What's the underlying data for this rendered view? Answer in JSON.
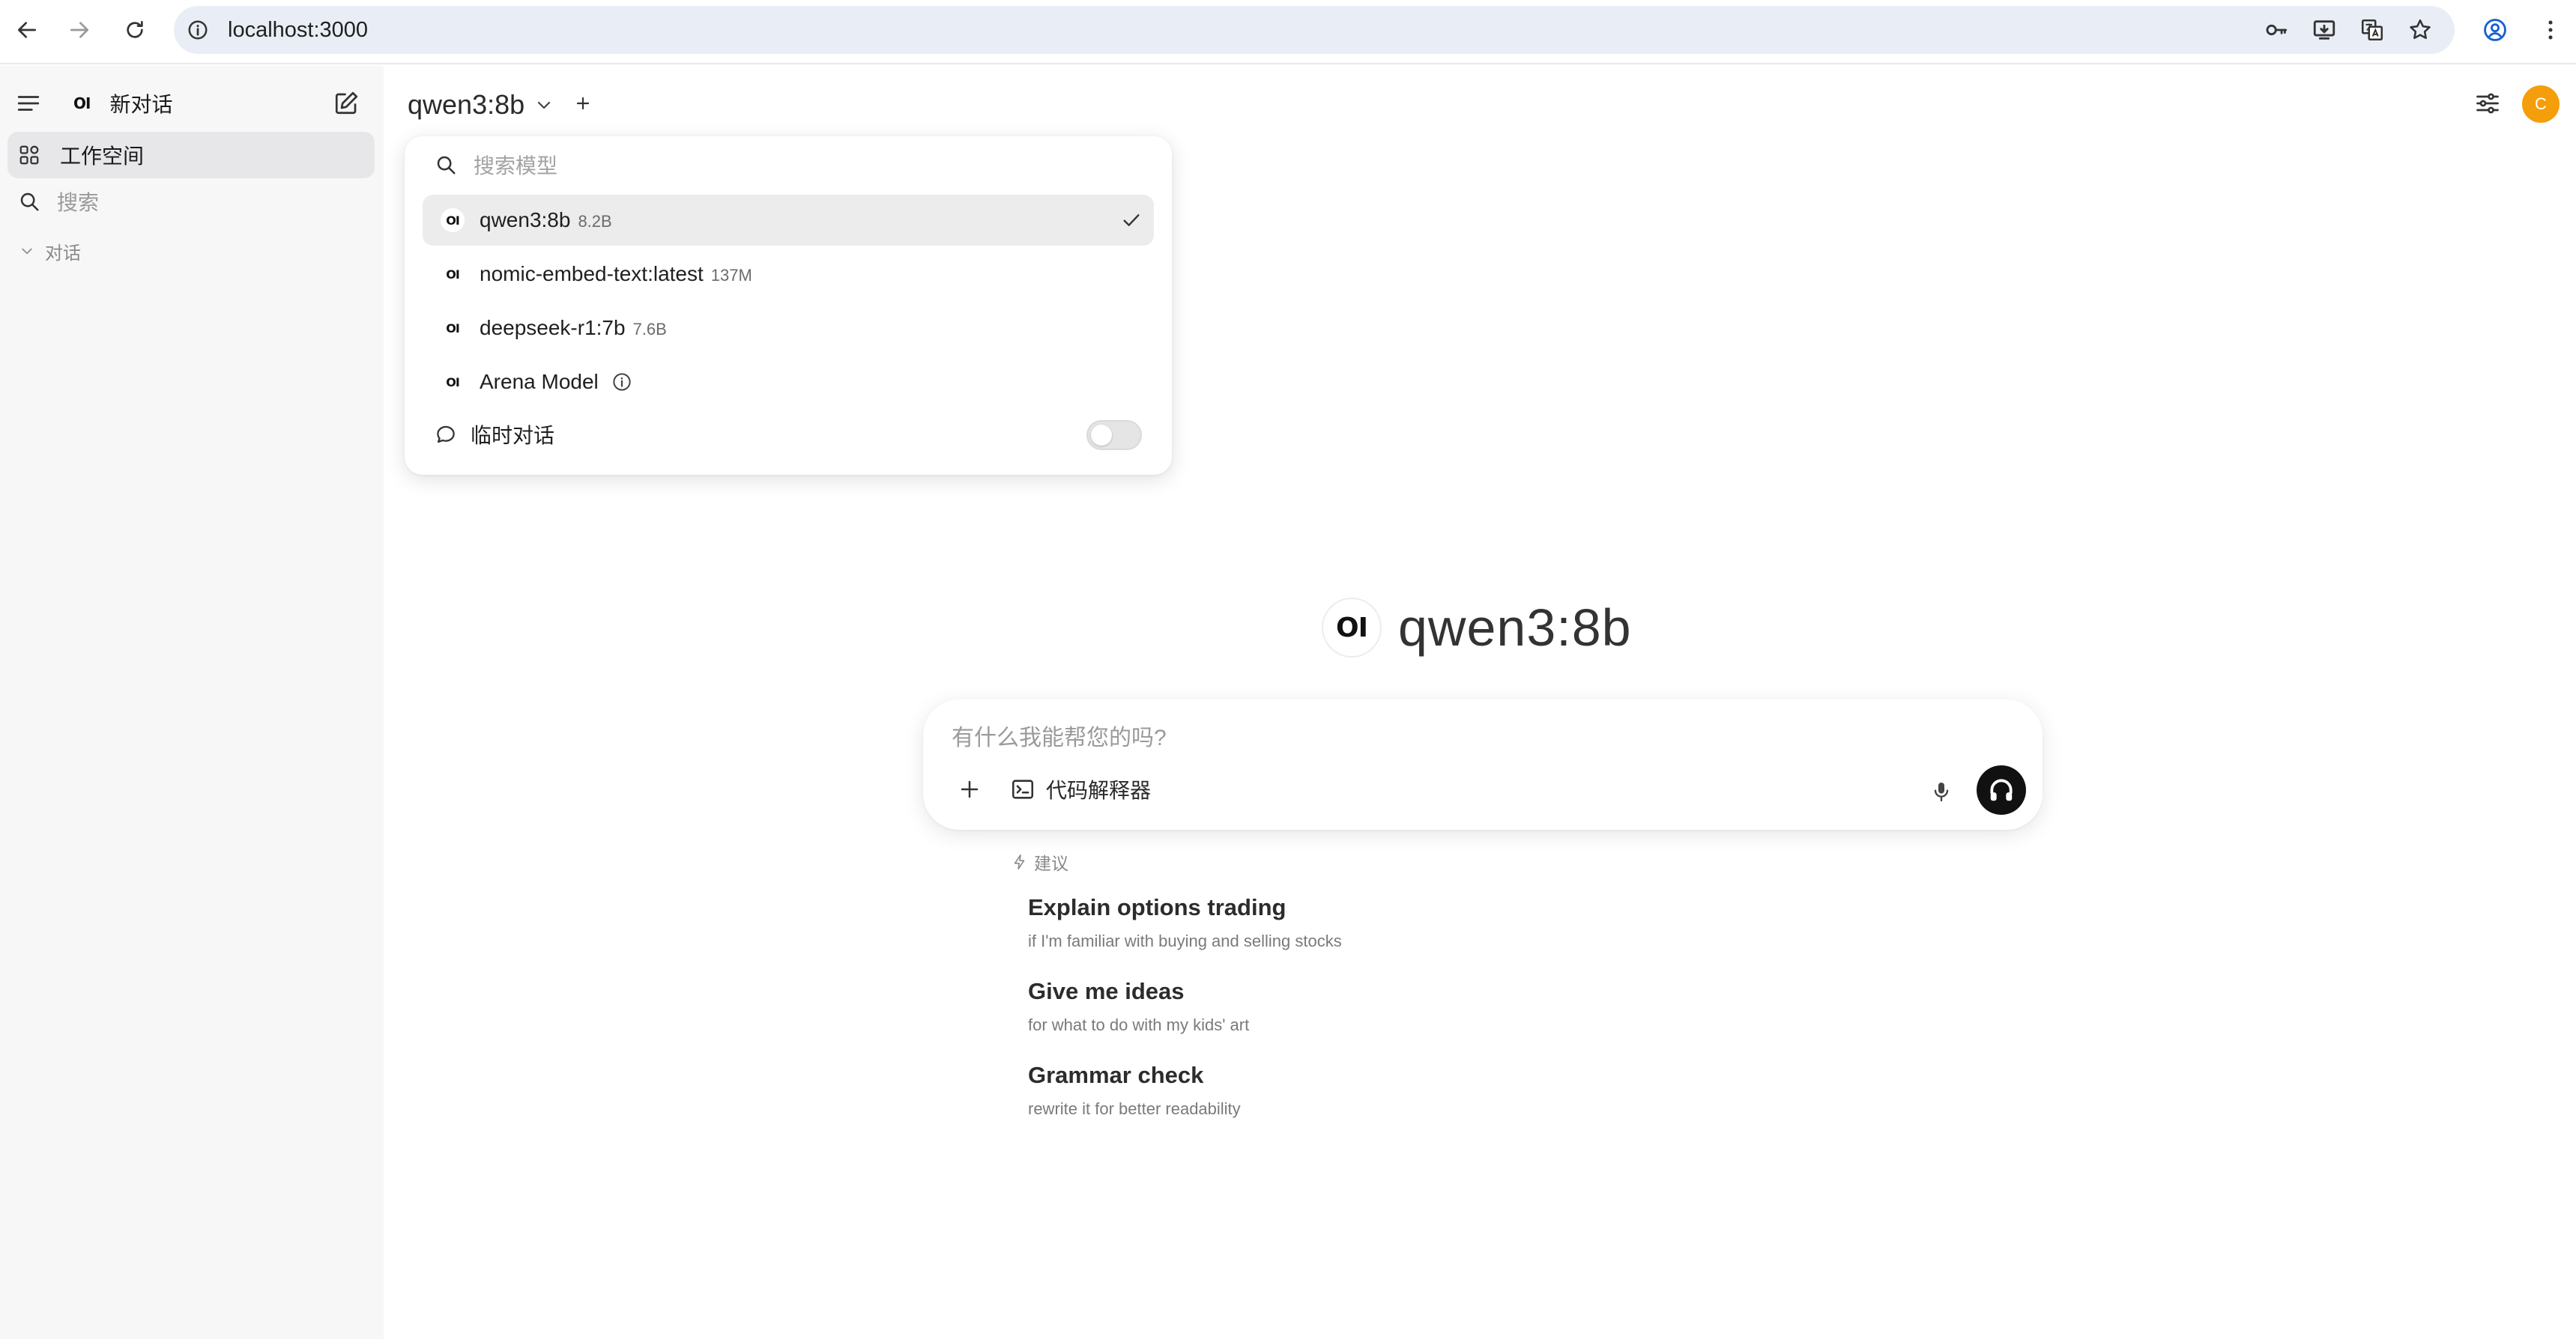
{
  "browser": {
    "url": "localhost:3000"
  },
  "sidebar": {
    "logo_text": "OI",
    "new_chat_label": "新对话",
    "workspace_label": "工作空间",
    "search_placeholder": "搜索",
    "section_label": "对话"
  },
  "header": {
    "selected_model": "qwen3:8b",
    "avatar_initial": "C"
  },
  "model_dropdown": {
    "search_placeholder": "搜索模型",
    "models": [
      {
        "name": "qwen3:8b",
        "size": "8.2B",
        "selected": true
      },
      {
        "name": "nomic-embed-text:latest",
        "size": "137M",
        "selected": false
      },
      {
        "name": "deepseek-r1:7b",
        "size": "7.6B",
        "selected": false
      },
      {
        "name": "Arena Model",
        "size": "",
        "selected": false
      }
    ],
    "temporary_chat_label": "临时对话",
    "temporary_chat_enabled": false
  },
  "main": {
    "hero_logo": "OI",
    "hero_model": "qwen3:8b",
    "composer_placeholder": "有什么我能帮您的吗?",
    "code_interpreter_label": "代码解释器",
    "suggestions_label": "建议",
    "suggestions": [
      {
        "title": "Explain options trading",
        "subtitle": "if I'm familiar with buying and selling stocks"
      },
      {
        "title": "Give me ideas",
        "subtitle": "for what to do with my kids' art"
      },
      {
        "title": "Grammar check",
        "subtitle": "rewrite it for better readability"
      }
    ]
  },
  "colors": {
    "avatar_bg": "#f59e0b",
    "sidebar_bg": "#f7f7f8",
    "selected_row_bg": "#ececec",
    "voice_button_bg": "#111111"
  }
}
